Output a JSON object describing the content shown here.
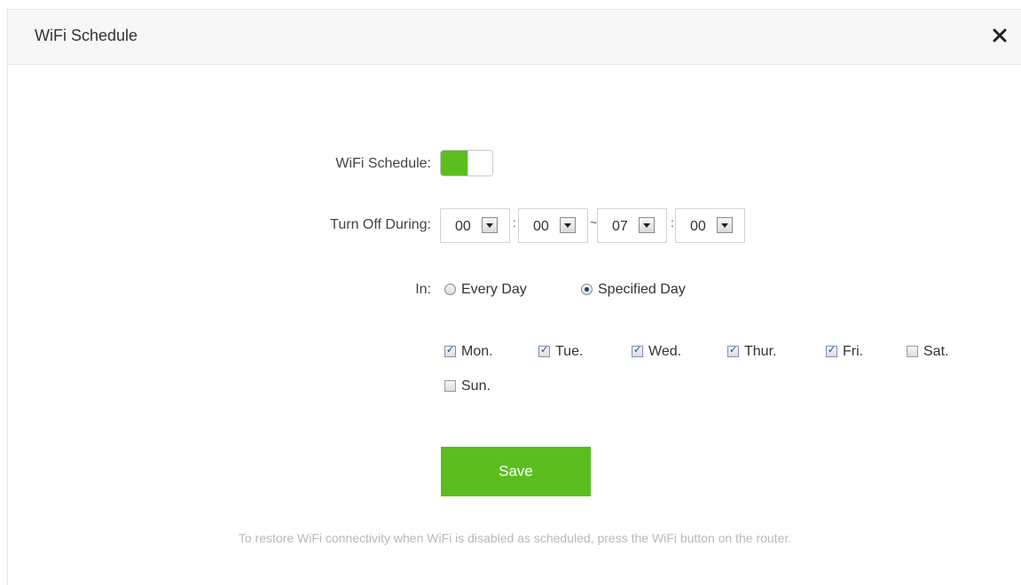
{
  "dialog": {
    "title": "WiFi Schedule",
    "close_icon": "close-icon"
  },
  "form": {
    "schedule_label": "WiFi Schedule:",
    "schedule_enabled": true,
    "turn_off_label": "Turn Off During:",
    "start_hour": "00",
    "start_minute": "00",
    "range_separator": "~",
    "end_hour": "07",
    "end_minute": "00",
    "time_separator": ":",
    "in_label": "In:",
    "radio_every_day": "Every Day",
    "radio_specified_day": "Specified Day",
    "selected_mode": "Specified Day",
    "days": [
      {
        "label": "Mon.",
        "checked": true
      },
      {
        "label": "Tue.",
        "checked": true
      },
      {
        "label": "Wed.",
        "checked": true
      },
      {
        "label": "Thur.",
        "checked": true
      },
      {
        "label": "Fri.",
        "checked": true
      },
      {
        "label": "Sat.",
        "checked": false
      },
      {
        "label": "Sun.",
        "checked": false
      }
    ],
    "save_label": "Save"
  },
  "note": "To restore WiFi connectivity when WiFi is disabled as scheduled, press the WiFi button on the router.",
  "colors": {
    "accent": "#5bbe1e",
    "note_text": "#b8b8b8"
  }
}
